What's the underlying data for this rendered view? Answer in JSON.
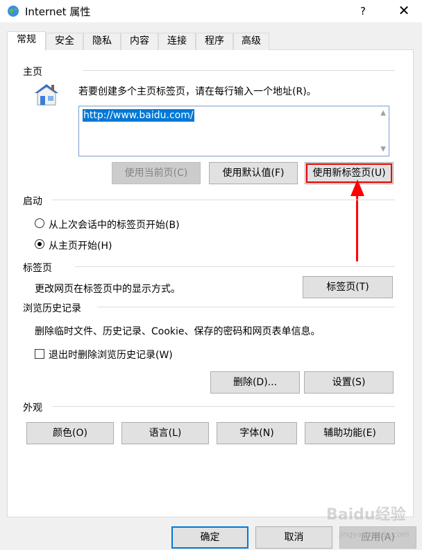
{
  "window": {
    "title": "Internet 属性",
    "help_label": "?",
    "close_label": "✕"
  },
  "tabs": [
    "常规",
    "安全",
    "隐私",
    "内容",
    "连接",
    "程序",
    "高级"
  ],
  "homepage": {
    "group_label": "主页",
    "instruction": "若要创建多个主页标签页，请在每行输入一个地址(R)。",
    "url": "http://www.baidu.com/",
    "btn_use_current": "使用当前页(C)",
    "btn_use_default": "使用默认值(F)",
    "btn_use_new_tab": "使用新标签页(U)"
  },
  "startup": {
    "group_label": "启动",
    "option_last_session": "从上次会话中的标签页开始(B)",
    "option_homepage": "从主页开始(H)",
    "selected": "option_homepage"
  },
  "tabs_section": {
    "group_label": "标签页",
    "description": "更改网页在标签页中的显示方式。",
    "btn_tabs": "标签页(T)"
  },
  "history": {
    "group_label": "浏览历史记录",
    "description": "删除临时文件、历史记录、Cookie、保存的密码和网页表单信息。",
    "checkbox_label": "退出时删除浏览历史记录(W)",
    "checkbox_checked": false,
    "btn_delete": "删除(D)...",
    "btn_settings": "设置(S)"
  },
  "appearance": {
    "group_label": "外观",
    "btn_colors": "颜色(O)",
    "btn_languages": "语言(L)",
    "btn_fonts": "字体(N)",
    "btn_accessibility": "辅助功能(E)"
  },
  "footer": {
    "btn_ok": "确定",
    "btn_cancel": "取消",
    "btn_apply": "应用(A)"
  },
  "watermark": {
    "text": "Baidu经验",
    "sub": "jingyan.baidu.com"
  },
  "colors": {
    "accent": "#0078d7",
    "highlight": "#e60000"
  }
}
